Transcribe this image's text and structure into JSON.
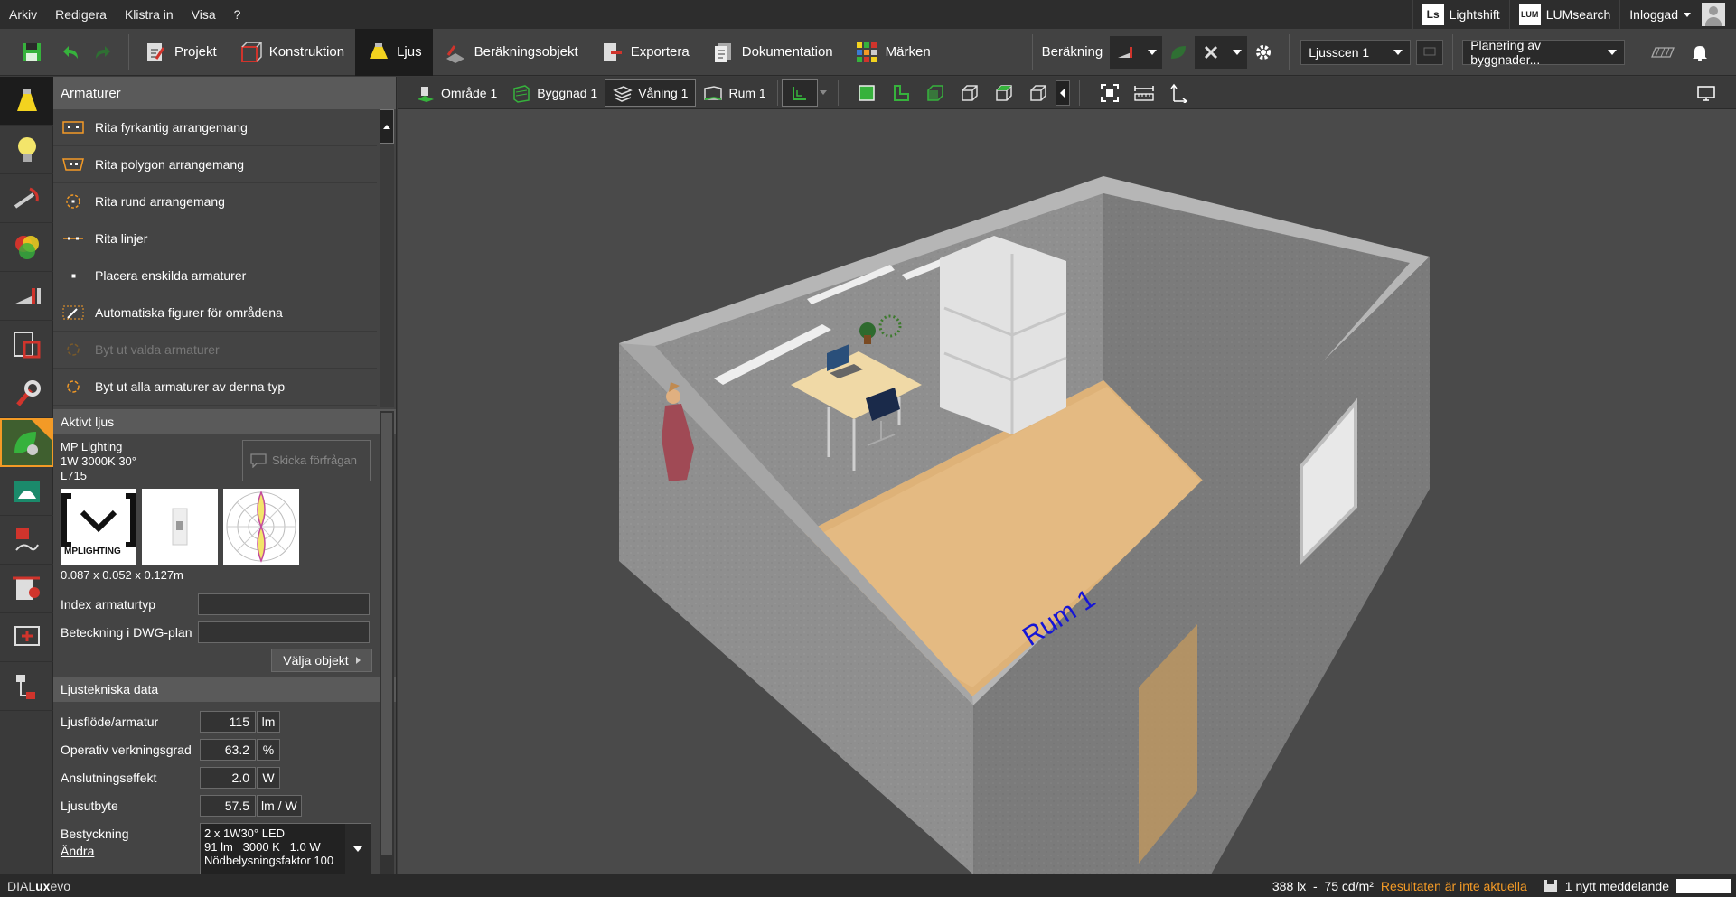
{
  "menu": {
    "items": [
      "Arkiv",
      "Redigera",
      "Klistra in",
      "Visa",
      "?"
    ],
    "lightshift": "Lightshift",
    "lightshift_logo": "Ls",
    "lumsearch": "LUMsearch",
    "lumsearch_logo": "LUM",
    "user": "Inloggad"
  },
  "toolbar": {
    "tabs": {
      "projekt": "Projekt",
      "konstruktion": "Konstruktion",
      "ljus": "Ljus",
      "berakningsobjekt": "Beräkningsobjekt",
      "exportera": "Exportera",
      "dokumentation": "Dokumentation",
      "marken": "Märken"
    },
    "berakning": "Beräkning",
    "scene_select": "Ljusscen 1",
    "planning_select": "Planering av byggnader..."
  },
  "panel": {
    "title": "Armaturer",
    "items": [
      "Rita fyrkantig arrangemang",
      "Rita polygon arrangemang",
      "Rita rund arrangemang",
      "Rita linjer",
      "Placera enskilda armaturer",
      "Automatiska figurer för områdena",
      "Byt ut valda armaturer",
      "Byt ut alla armaturer av denna typ"
    ],
    "active_light": {
      "header": "Aktivt ljus",
      "manufacturer": "MP Lighting",
      "spec": "1W 3000K 30°",
      "model": "L715",
      "send_request": "Skicka förfrågan",
      "logo_text": "MPLIGHTING",
      "dimensions": "0.087 x 0.052 x 0.127m",
      "index_label": "Index armaturtyp",
      "index_value": "",
      "dwg_label": "Beteckning i DWG-plan",
      "dwg_value": "",
      "select_object": "Välja objekt"
    },
    "tech": {
      "header": "Ljustekniska data",
      "rows": [
        {
          "label": "Ljusflöde/armatur",
          "value": "115",
          "unit": "lm"
        },
        {
          "label": "Operativ verkningsgrad",
          "value": "63.2",
          "unit": "%"
        },
        {
          "label": "Anslutningseffekt",
          "value": "2.0",
          "unit": "W"
        },
        {
          "label": "Ljusutbyte",
          "value": "57.5",
          "unit": "lm / W"
        }
      ],
      "besty_label": "Bestyckning",
      "besty_change": "Ändra",
      "besty_line1": "2 x 1W30° LED",
      "besty_line2": "91 lm   3000 K   1.0 W",
      "besty_line3": "Nödbelysningsfaktor 100"
    }
  },
  "view": {
    "crumbs": [
      "Område 1",
      "Byggnad 1",
      "Våning 1",
      "Rum 1"
    ],
    "room_label": "Rum 1"
  },
  "status": {
    "brand_prefix": "DIAL",
    "brand_bold": "ux",
    "brand_suffix": "evo",
    "values": "388 lx  -  75 cd/m²",
    "warning": "Resultaten är inte aktuella",
    "message": "1 nytt meddelande"
  },
  "colors": {
    "accent_active": "#1c1c1c",
    "green": "#36b23c",
    "orange": "#f39a26",
    "room_label": "#1515d6"
  }
}
